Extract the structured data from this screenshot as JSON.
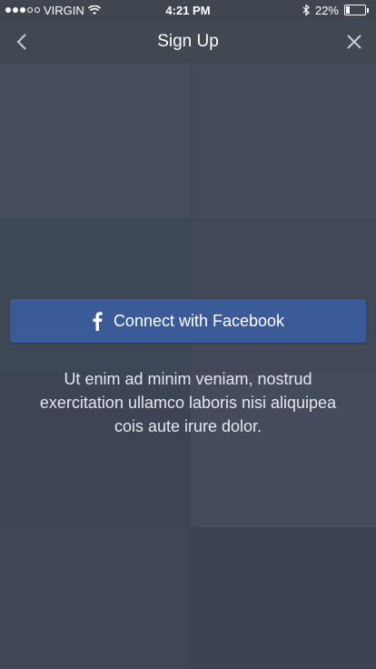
{
  "status_bar": {
    "carrier": "VIRGIN",
    "time": "4:21 PM",
    "battery_percent": "22%",
    "battery_level": 0.22,
    "signal_bars_filled": 3,
    "signal_bars_total": 5
  },
  "nav": {
    "title": "Sign Up",
    "back_icon": "chevron-left-icon",
    "close_icon": "close-icon"
  },
  "facebook_button": {
    "label": "Connect with Facebook",
    "icon": "facebook-icon",
    "color": "#3a5a98"
  },
  "description": "Ut enim ad minim veniam, nostrud exercitation ullamco laboris nisi aliquipea cois aute irure dolor."
}
